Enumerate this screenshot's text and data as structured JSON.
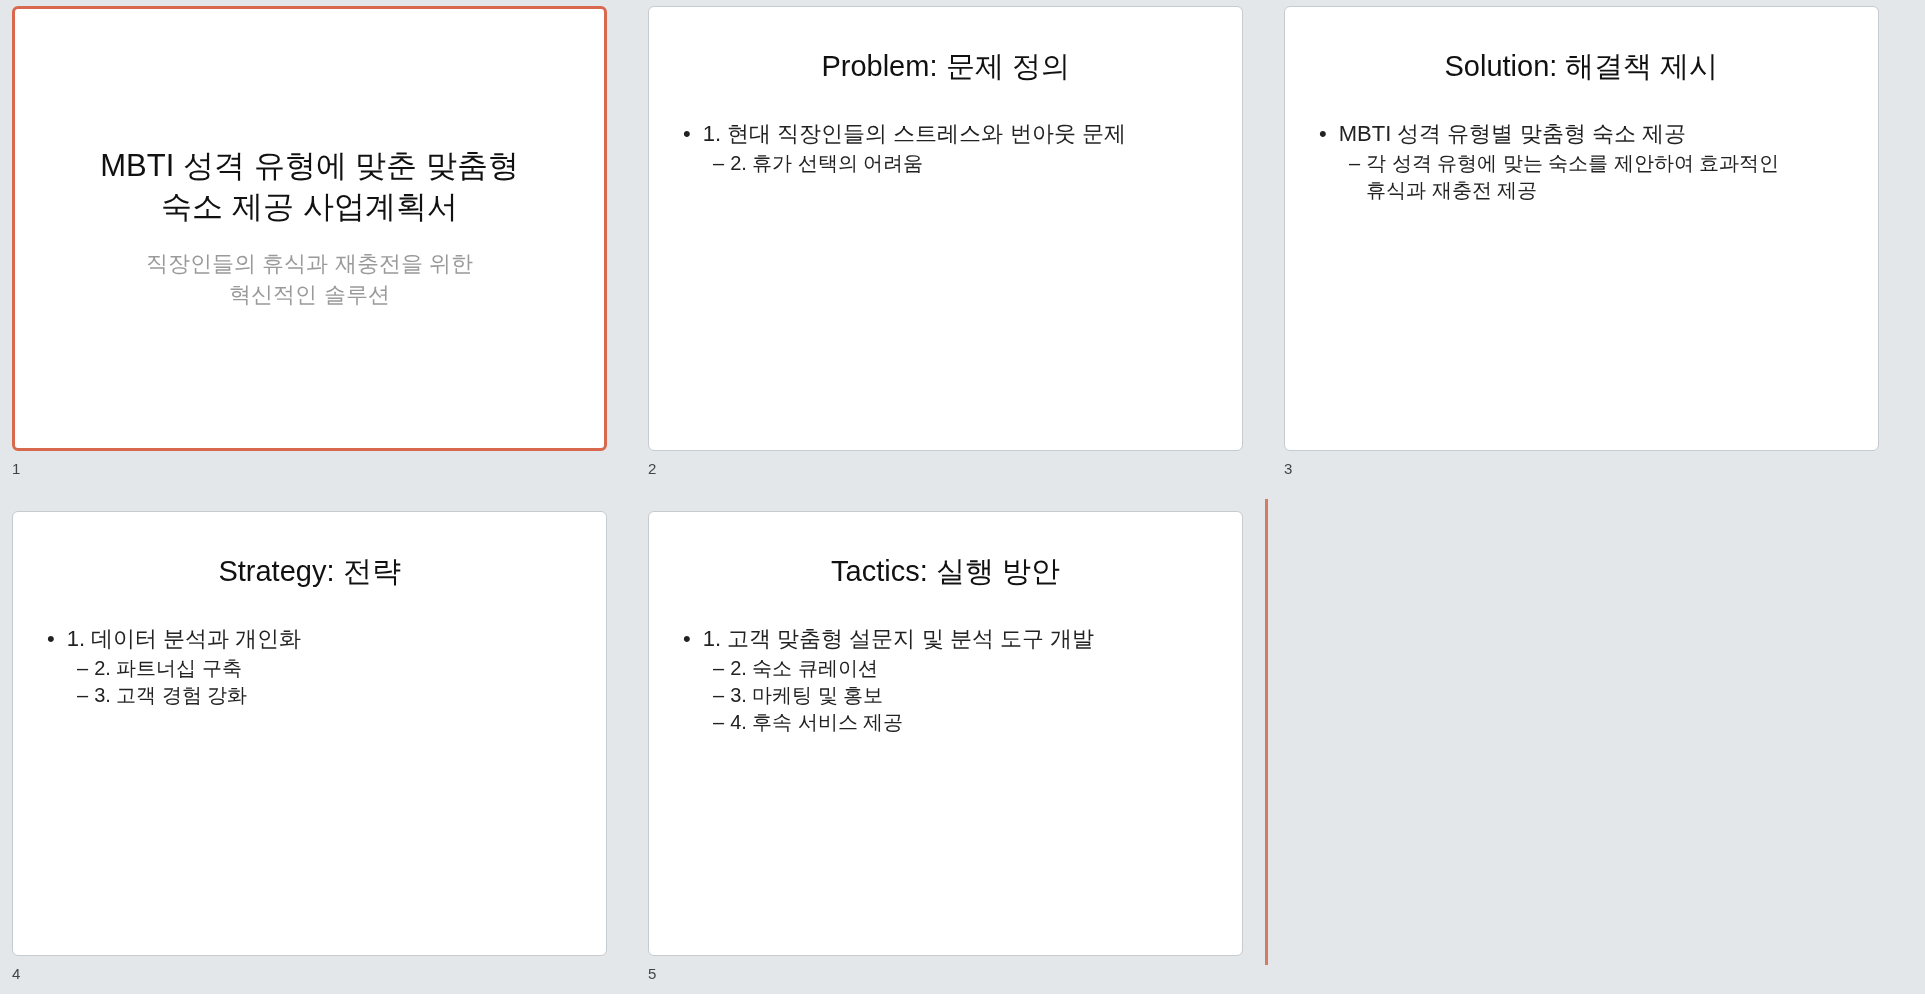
{
  "slides": [
    {
      "number": "1",
      "kind": "title",
      "selected": true,
      "drop_marker_after": false,
      "title": "MBTI 성격 유형에 맞춘 맞춤형 숙소 제공 사업계획서",
      "subtitle": "직장인들의 휴식과 재충전을 위한 혁신적인 솔루션"
    },
    {
      "number": "2",
      "kind": "content",
      "selected": false,
      "drop_marker_after": false,
      "title": "Problem: 문제 정의",
      "bullets": [
        {
          "marker": "•",
          "text": "1. 현대 직장인들의 스트레스와 번아웃 문제",
          "children": [
            {
              "marker": "–",
              "text": "2. 휴가 선택의 어려움"
            }
          ]
        }
      ]
    },
    {
      "number": "3",
      "kind": "content",
      "selected": false,
      "drop_marker_after": false,
      "title": "Solution: 해결책 제시",
      "bullets": [
        {
          "marker": "•",
          "text": "MBTI 성격 유형별 맞춤형 숙소 제공",
          "children": [
            {
              "marker": "–",
              "text": "각 성격 유형에 맞는 숙소를 제안하여 효과적인 휴식과 재충전 제공"
            }
          ]
        }
      ]
    },
    {
      "number": "4",
      "kind": "content",
      "selected": false,
      "drop_marker_after": false,
      "title": "Strategy: 전략",
      "bullets": [
        {
          "marker": "•",
          "text": "1. 데이터 분석과 개인화",
          "children": [
            {
              "marker": "–",
              "text": "2. 파트너십 구축"
            },
            {
              "marker": "–",
              "text": "3. 고객 경험 강화"
            }
          ]
        }
      ]
    },
    {
      "number": "5",
      "kind": "content",
      "selected": false,
      "drop_marker_after": true,
      "title": "Tactics: 실행 방안",
      "bullets": [
        {
          "marker": "•",
          "text": "1. 고객 맞춤형 설문지 및 분석 도구 개발",
          "children": [
            {
              "marker": "–",
              "text": "2. 숙소 큐레이션"
            },
            {
              "marker": "–",
              "text": "3. 마케팅 및 홍보"
            },
            {
              "marker": "–",
              "text": "4. 후속 서비스 제공"
            }
          ]
        }
      ]
    }
  ]
}
